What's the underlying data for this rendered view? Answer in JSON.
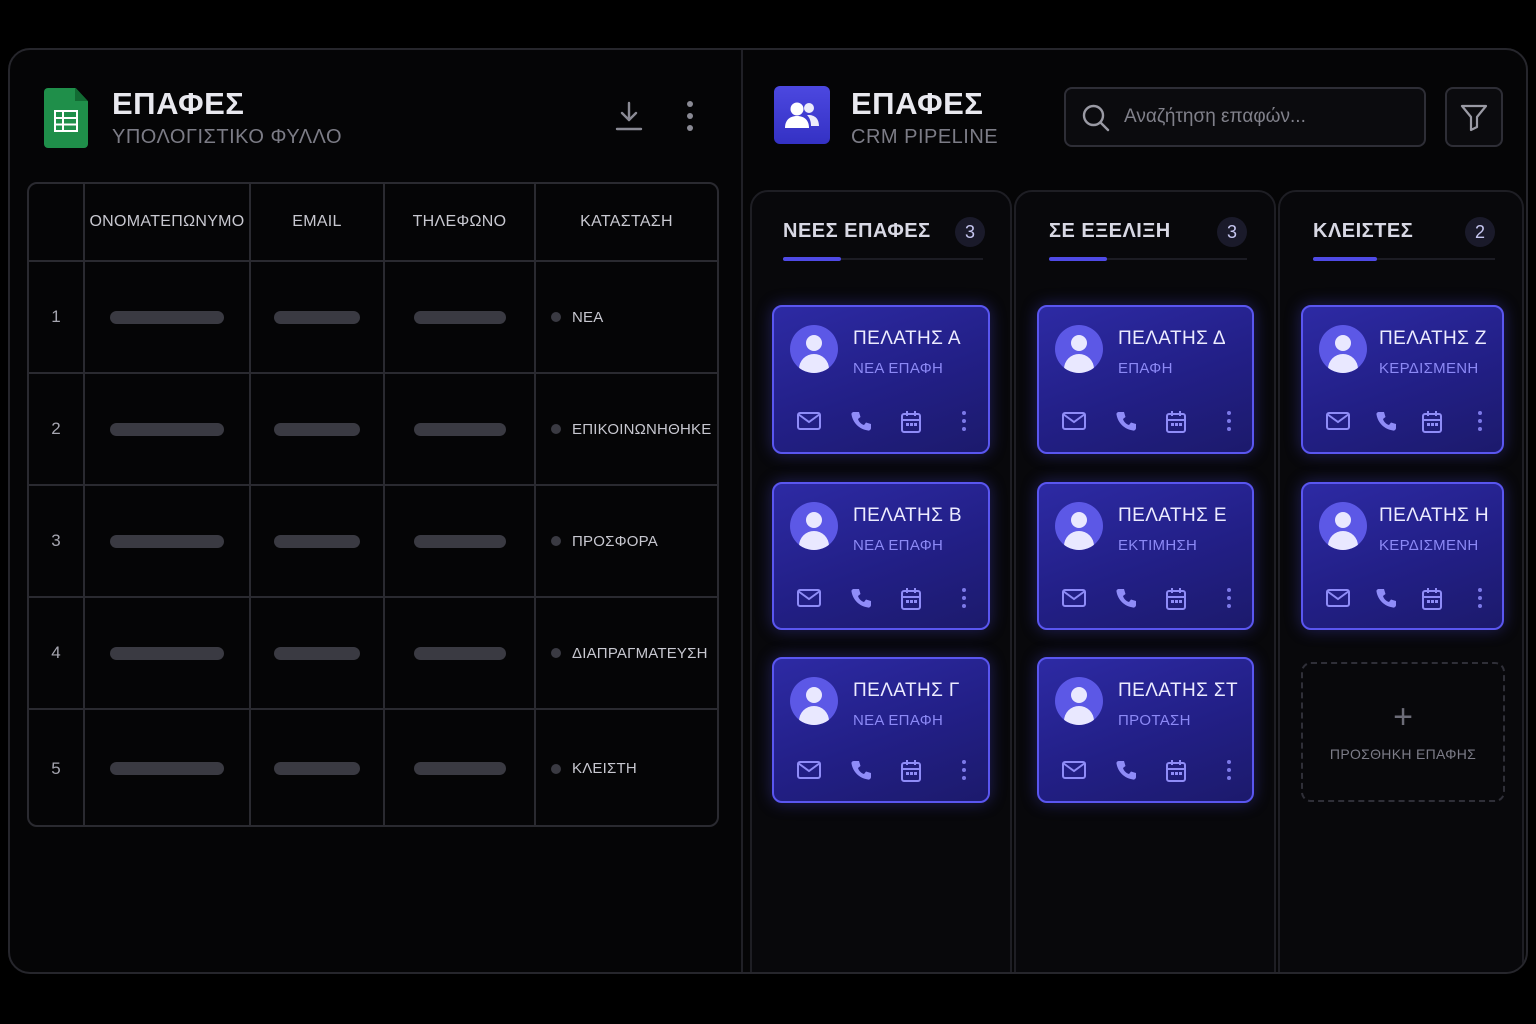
{
  "sheet": {
    "title": "ΕΠΑΦΕΣ",
    "subtitle": "ΥΠΟΛΟΓΙΣΤΙΚΟ ΦΥΛΛΟ",
    "icons": [
      "spreadsheet-icon",
      "download-icon",
      "more-vertical-icon"
    ],
    "columns": [
      "ΟΝΟΜΑΤΕΠΩΝΥΜΟ",
      "EMAIL",
      "ΤΗΛΕΦΩΝΟ",
      "ΚΑΤΑΣΤΑΣΗ"
    ],
    "rows": [
      {
        "num": "1",
        "status": "ΝΕΑ"
      },
      {
        "num": "2",
        "status": "ΕΠΙΚΟΙΝΩΝΗΘΗΚΕ"
      },
      {
        "num": "3",
        "status": "ΠΡΟΣΦΟΡΑ"
      },
      {
        "num": "4",
        "status": "ΔΙΑΠΡΑΓΜΑΤΕΥΣΗ"
      },
      {
        "num": "5",
        "status": "ΚΛΕΙΣΤΗ"
      }
    ]
  },
  "crm": {
    "title": "ΕΠΑΦΕΣ",
    "subtitle": "CRM PIPELINE",
    "search_placeholder": "Αναζήτηση επαφών...",
    "icons": [
      "users-icon",
      "search-icon",
      "filter-icon"
    ],
    "columns": [
      {
        "title": "ΝΕΕΣ ΕΠΑΦΕΣ",
        "count": "3",
        "cards": [
          {
            "name": "ΠΕΛΑΤΗΣ Α",
            "stage": "ΝΕΑ ΕΠΑΦΗ"
          },
          {
            "name": "ΠΕΛΑΤΗΣ Β",
            "stage": "ΝΕΑ ΕΠΑΦΗ"
          },
          {
            "name": "ΠΕΛΑΤΗΣ Γ",
            "stage": "ΝΕΑ ΕΠΑΦΗ"
          }
        ]
      },
      {
        "title": "ΣΕ ΕΞΕΛΙΞΗ",
        "count": "3",
        "cards": [
          {
            "name": "ΠΕΛΑΤΗΣ Δ",
            "stage": "ΕΠΑΦΗ"
          },
          {
            "name": "ΠΕΛΑΤΗΣ Ε",
            "stage": "ΕΚΤΙΜΗΣΗ"
          },
          {
            "name": "ΠΕΛΑΤΗΣ ΣΤ",
            "stage": "ΠΡΟΤΑΣΗ"
          }
        ]
      },
      {
        "title": "ΚΛΕΙΣΤΕΣ",
        "count": "2",
        "cards": [
          {
            "name": "ΠΕΛΑΤΗΣ Ζ",
            "stage": "ΚΕΡΔΙΣΜΕΝΗ"
          },
          {
            "name": "ΠΕΛΑΤΗΣ Η",
            "stage": "ΚΕΡΔΙΣΜΕΝΗ"
          }
        ],
        "add_label": "ΠΡΟΣΘΗΚΗ ΕΠΑΦΗΣ"
      }
    ],
    "card_action_icons": [
      "mail-icon",
      "phone-icon",
      "calendar-icon",
      "more-vertical-icon"
    ]
  },
  "colors": {
    "background": "#000000",
    "panel": "#050506",
    "accent": "#4f4ae6",
    "card": "#2d2aa4",
    "sheet_green": "#1f8f4a"
  }
}
